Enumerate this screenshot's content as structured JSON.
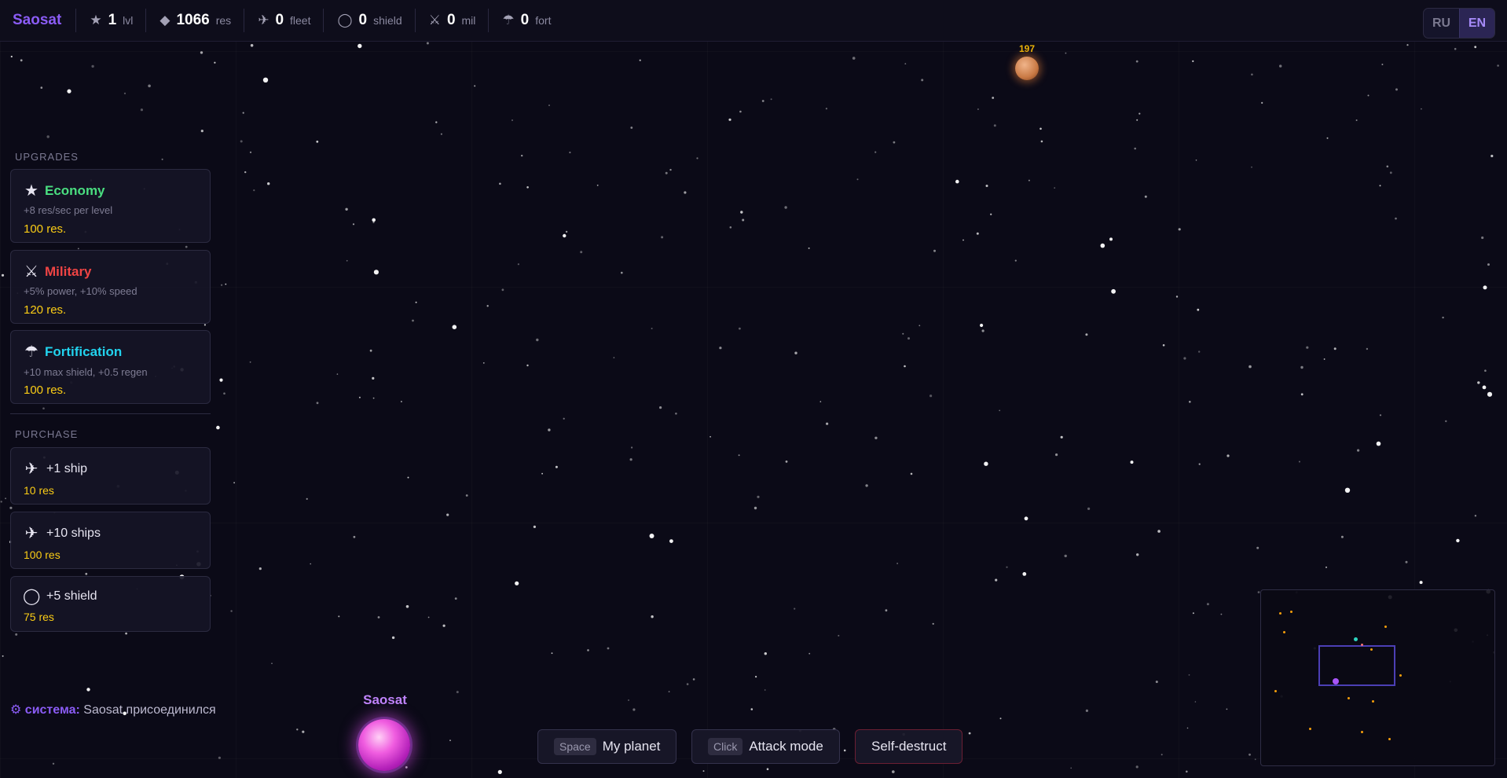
{
  "brand": "Saosat",
  "stats": [
    {
      "icon": "star-icon",
      "glyph": "★",
      "value": "1",
      "unit": "lvl"
    },
    {
      "icon": "diamond-icon",
      "glyph": "◆",
      "value": "1066",
      "unit": "res"
    },
    {
      "icon": "airplane-icon",
      "glyph": "✈",
      "value": "0",
      "unit": "fleet"
    },
    {
      "icon": "circle-icon",
      "glyph": "◯",
      "value": "0",
      "unit": "shield"
    },
    {
      "icon": "crossed-swords-icon",
      "glyph": "⚔",
      "value": "0",
      "unit": "mil"
    },
    {
      "icon": "umbrella-icon",
      "glyph": "☂",
      "value": "0",
      "unit": "fort"
    }
  ],
  "lang": {
    "ru": "RU",
    "en": "EN",
    "active": "EN"
  },
  "upgrades": {
    "title": "UPGRADES",
    "items": [
      {
        "glyph": "★",
        "title": "Economy",
        "color": "#4ade80",
        "desc": "+8 res/sec per level",
        "cost": "100 res."
      },
      {
        "glyph": "⚔",
        "title": "Military",
        "color": "#ef4444",
        "desc": "+5% power, +10% speed",
        "cost": "120 res."
      },
      {
        "glyph": "☂",
        "title": "Fortification",
        "color": "#22d3ee",
        "desc": "+10 max shield, +0.5 regen",
        "cost": "100 res."
      }
    ]
  },
  "purchase": {
    "title": "PURCHASE",
    "items": [
      {
        "glyph": "✈",
        "title": "+1 ship",
        "cost": "10 res"
      },
      {
        "glyph": "✈",
        "title": "+10 ships",
        "cost": "100 res"
      },
      {
        "glyph": "◯",
        "title": "+5 shield",
        "cost": "75 res"
      }
    ]
  },
  "chat": {
    "prefix_glyph": "⚙",
    "prefix": "система:",
    "message": "Saosat присоединился"
  },
  "planets": {
    "mine": {
      "name": "Saosat",
      "color": "#e04be0"
    },
    "enemy": {
      "label": "197",
      "color": "#d2864e"
    }
  },
  "buttons": {
    "my_planet": {
      "key": "Space",
      "label": "My planet"
    },
    "attack": {
      "key": "Click",
      "label": "Attack mode"
    },
    "self_destruct": {
      "label": "Self-destruct"
    }
  },
  "colors": {
    "accent": "#8b5cf6",
    "cost": "#facc15",
    "background": "#0b0a17"
  }
}
